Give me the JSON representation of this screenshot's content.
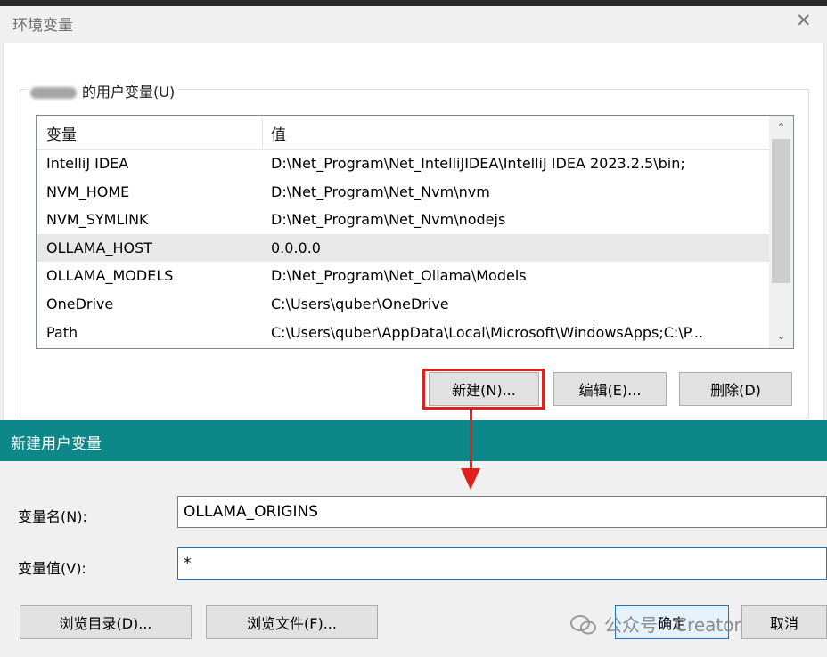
{
  "window": {
    "title": "环境变量",
    "close_glyph": "✕"
  },
  "user_vars": {
    "group_label": "的用户变量(U)",
    "col_var": "变量",
    "col_val": "值",
    "rows": [
      {
        "name": "IntelliJ IDEA",
        "value": "D:\\Net_Program\\Net_IntelliJIDEA\\IntelliJ IDEA 2023.2.5\\bin;"
      },
      {
        "name": "NVM_HOME",
        "value": "D:\\Net_Program\\Net_Nvm\\nvm"
      },
      {
        "name": "NVM_SYMLINK",
        "value": "D:\\Net_Program\\Net_Nvm\\nodejs"
      },
      {
        "name": "OLLAMA_HOST",
        "value": "0.0.0.0"
      },
      {
        "name": "OLLAMA_MODELS",
        "value": "D:\\Net_Program\\Net_Ollama\\Models"
      },
      {
        "name": "OneDrive",
        "value": "C:\\Users\\quber\\OneDrive"
      },
      {
        "name": "Path",
        "value": "C:\\Users\\quber\\AppData\\Local\\Microsoft\\WindowsApps;C:\\P..."
      }
    ],
    "selected_row": 3,
    "scroll_up": "⌃",
    "scroll_down": "⌄",
    "btn_new": "新建(N)...",
    "btn_edit": "编辑(E)...",
    "btn_delete": "删除(D)"
  },
  "new_dialog": {
    "title": "新建用户变量",
    "name_label": "变量名(N):",
    "name_value": "OLLAMA_ORIGINS",
    "value_label": "变量值(V):",
    "value_value": "*",
    "btn_browse_dir": "浏览目录(D)...",
    "btn_browse_file": "浏览文件(F)...",
    "btn_ok": "确定",
    "btn_cancel": "取消"
  },
  "watermark": {
    "text": "公众号 · Creator"
  },
  "colors": {
    "title_bar": "#0d8788",
    "highlight": "#e1201a",
    "focus": "#1a73c4"
  }
}
